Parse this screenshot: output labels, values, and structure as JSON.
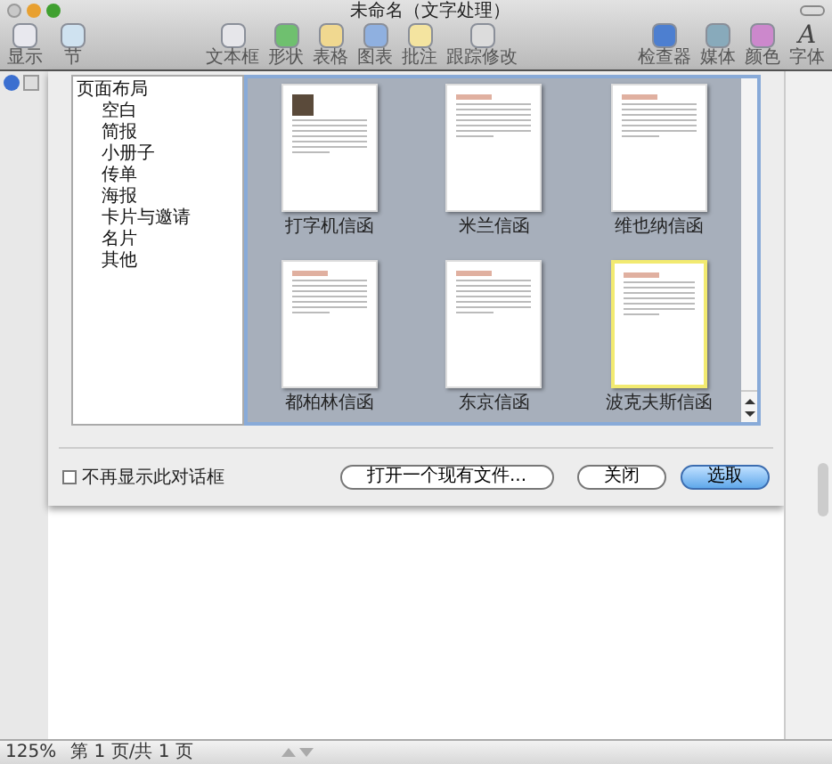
{
  "window": {
    "title": "未命名（文字处理）"
  },
  "toolbar": {
    "left": [
      {
        "label": "显示"
      },
      {
        "label": "节"
      }
    ],
    "center": [
      {
        "label": "文本框"
      },
      {
        "label": "形状"
      },
      {
        "label": "表格"
      },
      {
        "label": "图表"
      },
      {
        "label": "批注"
      },
      {
        "label": "跟踪修改"
      }
    ],
    "right": [
      {
        "label": "检查器"
      },
      {
        "label": "媒体"
      },
      {
        "label": "颜色"
      },
      {
        "label": "字体",
        "glyph": "A"
      }
    ]
  },
  "categories": [
    {
      "label": "页面布局",
      "children": [
        {
          "label": "空白"
        },
        {
          "label": "简报"
        },
        {
          "label": "小册子"
        },
        {
          "label": "传单"
        },
        {
          "label": "海报"
        },
        {
          "label": "卡片与邀请"
        },
        {
          "label": "名片"
        },
        {
          "label": "其他"
        }
      ]
    }
  ],
  "templates": [
    {
      "name": "打字机信函",
      "selected": false,
      "kind": "photo"
    },
    {
      "name": "米兰信函",
      "selected": false,
      "kind": "plain"
    },
    {
      "name": "维也纳信函",
      "selected": false,
      "kind": "plain"
    },
    {
      "name": "都柏林信函",
      "selected": false,
      "kind": "plain"
    },
    {
      "name": "东京信函",
      "selected": false,
      "kind": "plain"
    },
    {
      "name": "波克夫斯信函",
      "selected": true,
      "kind": "plain"
    }
  ],
  "dont_show": {
    "label": "不再显示此对话框",
    "checked": false
  },
  "buttons": [
    {
      "label": "打开一个现有文件...",
      "kind": "normal"
    },
    {
      "label": "关闭",
      "kind": "normal"
    },
    {
      "label": "选取",
      "kind": "default"
    }
  ],
  "status_bar": {
    "zoom": "125%",
    "page": "第 1 页/共 1 页"
  }
}
